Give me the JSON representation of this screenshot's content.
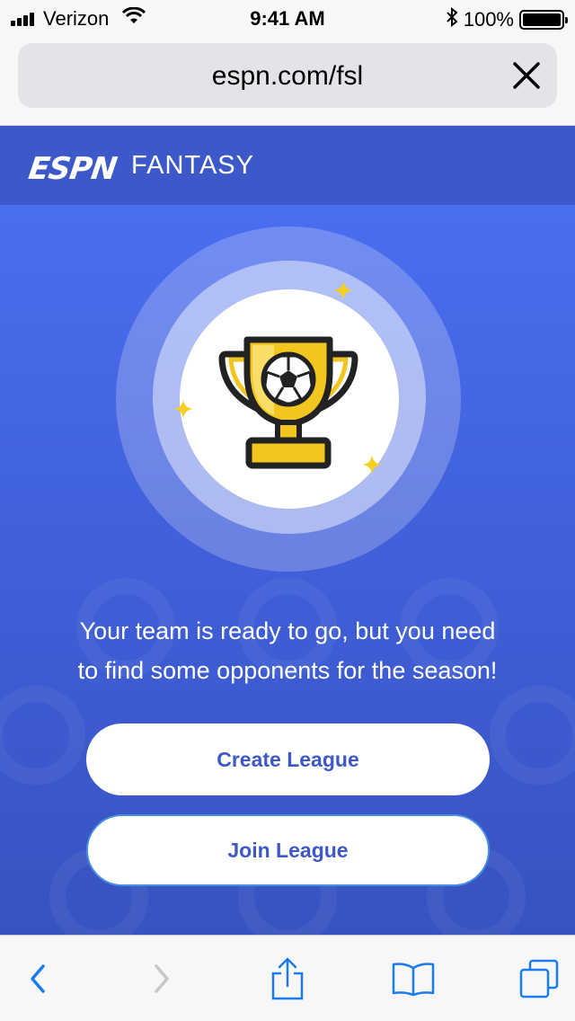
{
  "status_bar": {
    "carrier": "Verizon",
    "time": "9:41 AM",
    "battery": "100%",
    "battery_level": 1.0
  },
  "browser": {
    "url": "espn.com/fsl",
    "close_icon": "close-icon"
  },
  "header": {
    "logo_text": "ESPN",
    "section": "FANTASY",
    "color": "#3d58c8"
  },
  "hero": {
    "trophy_icon": "soccer-trophy-icon",
    "message_line1": "Your team is ready to go, but you need",
    "message_line2": "to find some opponents for the season!"
  },
  "actions": {
    "create_label": "Create League",
    "join_label": "Join League"
  },
  "toolbar": {
    "back_icon": "chevron-left-icon",
    "forward_icon": "chevron-right-icon",
    "share_icon": "share-icon",
    "bookmarks_icon": "book-icon",
    "tabs_icon": "tabs-icon",
    "accent": "#1a7cf0"
  },
  "colors": {
    "primary_blue": "#4a6ef0",
    "button_text": "#3d58c8",
    "sparkle": "#f5d020",
    "trophy_gold": "#f3c61f"
  }
}
